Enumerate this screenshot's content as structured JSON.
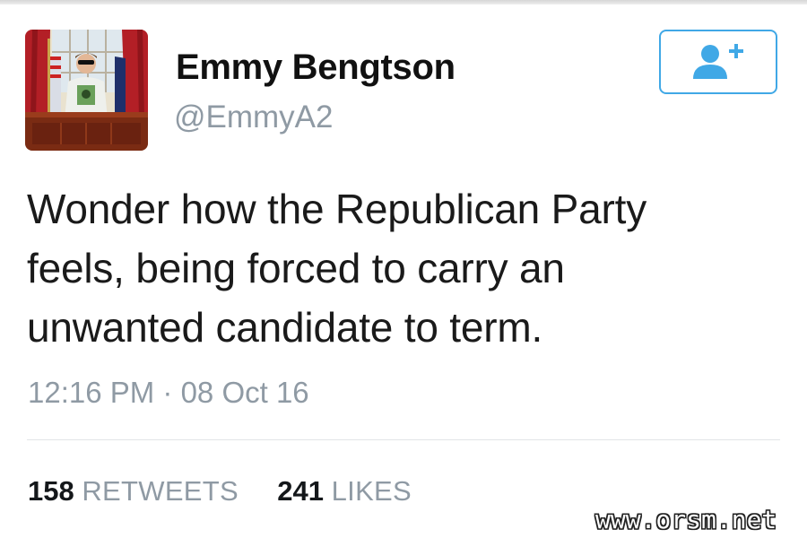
{
  "user": {
    "display_name": "Emmy Bengtson",
    "handle": "@EmmyA2"
  },
  "follow_button": {
    "icon": "add-user-icon",
    "accent_color": "#40a8e6"
  },
  "tweet": {
    "text_lines": [
      "Wonder how the Republican Party",
      "feels, being forced to carry an",
      "unwanted candidate to term."
    ],
    "timestamp": "12:16 PM · 08 Oct 16"
  },
  "stats": {
    "retweets_count": "158",
    "retweets_label": "RETWEETS",
    "likes_count": "241",
    "likes_label": "LIKES"
  },
  "watermark": "www.orsm.net"
}
